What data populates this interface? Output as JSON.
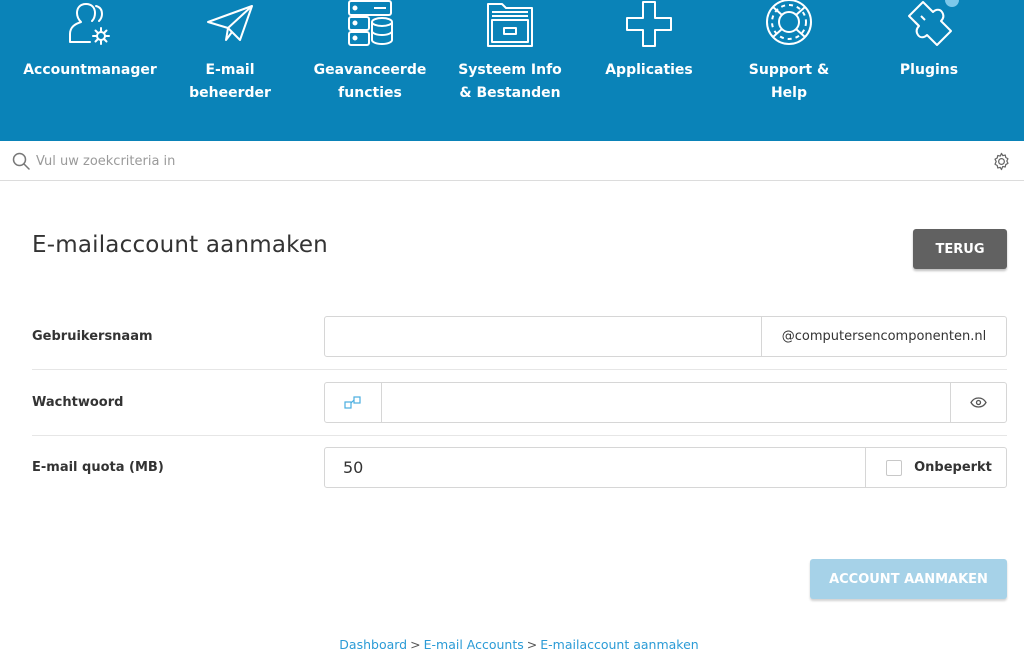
{
  "nav": {
    "items": [
      {
        "label_1": "Accountmanager",
        "label_2": "",
        "icon": "users-settings-icon"
      },
      {
        "label_1": "E-mail",
        "label_2": "beheerder",
        "icon": "paper-plane-icon"
      },
      {
        "label_1": "Geavanceerde",
        "label_2": "functies",
        "icon": "server-database-icon"
      },
      {
        "label_1": "Systeem Info",
        "label_2": "& Bestanden",
        "icon": "folder-icon"
      },
      {
        "label_1": "Applicaties",
        "label_2": "",
        "icon": "plus-icon"
      },
      {
        "label_1": "Support &",
        "label_2": "Help",
        "icon": "lifebuoy-icon"
      },
      {
        "label_1": "Plugins",
        "label_2": "",
        "icon": "puzzle-icon"
      }
    ]
  },
  "search": {
    "placeholder": "Vul uw zoekcriteria in",
    "value": ""
  },
  "page": {
    "title": "E-mailaccount aanmaken",
    "back_label": "TERUG"
  },
  "form": {
    "username": {
      "label": "Gebruikersnaam",
      "value": "",
      "domain_suffix": "@computersencomponenten.nl"
    },
    "password": {
      "label": "Wachtwoord",
      "value": ""
    },
    "quota": {
      "label": "E-mail quota (MB)",
      "value": "50",
      "unlimited_label": "Onbeperkt",
      "unlimited_checked": false
    },
    "submit_label": "ACCOUNT AANMAKEN"
  },
  "breadcrumb": {
    "items": [
      "Dashboard",
      "E-mail Accounts",
      "E-mailaccount aanmaken"
    ],
    "separator": ">"
  },
  "colors": {
    "header_bg": "#0a83b8",
    "back_button": "#616161",
    "submit_button_disabled": "#a6d2e8",
    "link": "#2b9bd6"
  }
}
